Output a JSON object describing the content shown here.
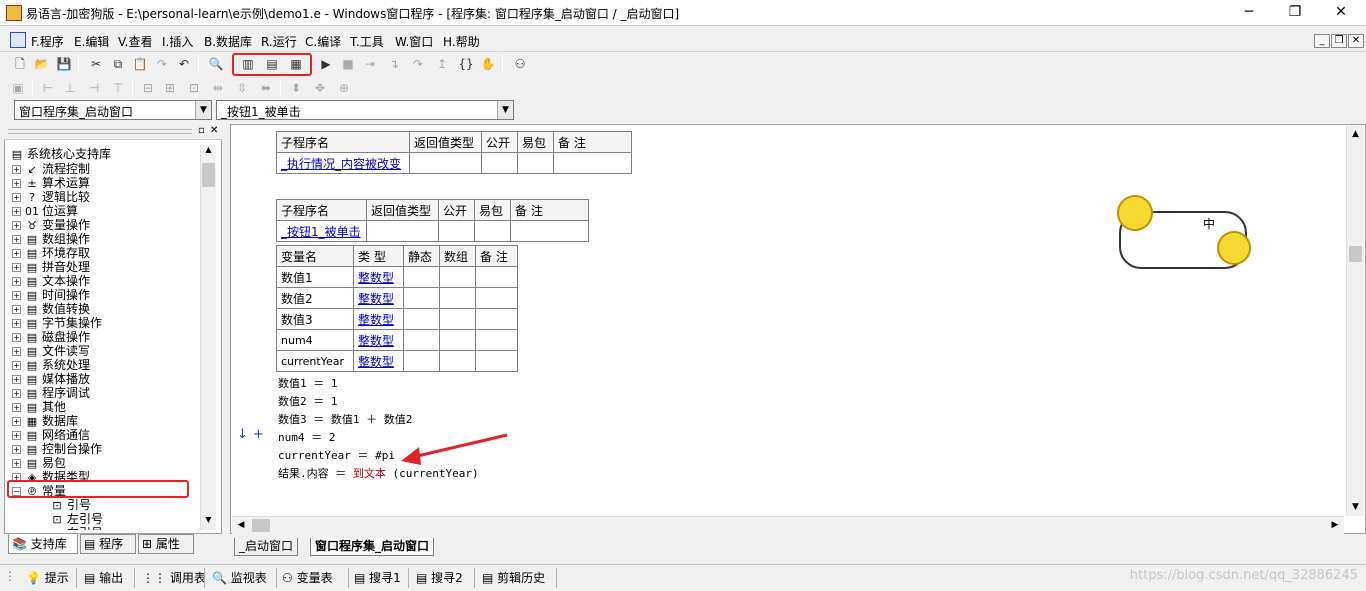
{
  "window": {
    "title": "易语言-加密狗版 - E:\\personal-learn\\e示例\\demo1.e - Windows窗口程序 - [程序集: 窗口程序集_启动窗口 / _启动窗口]"
  },
  "menu": [
    "F.程序",
    "E.编辑",
    "V.查看",
    "I.插入",
    "B.数据库",
    "R.运行",
    "C.编译",
    "T.工具",
    "W.窗口",
    "H.帮助"
  ],
  "combos": {
    "class": "窗口程序集_启动窗口",
    "method": "_按钮1_被单击"
  },
  "tree": {
    "root": "系统核心支持库",
    "items": [
      "流程控制",
      "算术运算",
      "逻辑比较",
      "位运算",
      "变量操作",
      "数组操作",
      "环境存取",
      "拼音处理",
      "文本操作",
      "时间操作",
      "数值转换",
      "字节集操作",
      "磁盘操作",
      "文件读写",
      "系统处理",
      "媒体播放",
      "程序调试",
      "其他",
      "数据库",
      "网络通信",
      "控制台操作",
      "易包",
      "数据类型",
      "常量"
    ],
    "children": [
      "引号",
      "左引号",
      "右引号"
    ]
  },
  "left_tabs": [
    "支持库",
    "程序",
    "属性"
  ],
  "sub1": {
    "headers": [
      "子程序名",
      "返回值类型",
      "公开",
      "易包",
      "备 注"
    ],
    "name": "_执行情况_内容被改变"
  },
  "sub2": {
    "headers": [
      "子程序名",
      "返回值类型",
      "公开",
      "易包",
      "备 注"
    ],
    "name": "_按钮1_被单击"
  },
  "vars": {
    "headers": [
      "变量名",
      "类 型",
      "静态",
      "数组",
      "备 注"
    ],
    "rows": [
      {
        "name": "数值1",
        "type": "整数型"
      },
      {
        "name": "数值2",
        "type": "整数型"
      },
      {
        "name": "数值3",
        "type": "整数型"
      },
      {
        "name": "num4",
        "type": "整数型"
      },
      {
        "name": "currentYear",
        "type": "整数型"
      }
    ]
  },
  "code": {
    "l1": "数值1 ＝ 1",
    "l2": "数值2 ＝ 1",
    "l3": "数值3 ＝ 数值1 ＋ 数值2",
    "l4": "num4 ＝ 2",
    "l5": "currentYear ＝ #pi",
    "l6_a": "结果.内容 ＝ ",
    "l6_b": "到文本",
    "l6_c": " (currentYear)"
  },
  "sticker_text": "中",
  "doc_tabs": [
    "_启动窗口",
    "窗口程序集_启动窗口"
  ],
  "status": [
    "提示",
    "输出",
    "调用表",
    "监视表",
    "变量表",
    "搜寻1",
    "搜寻2",
    "剪辑历史"
  ],
  "watermark": "https://blog.csdn.net/qq_32886245",
  "colors": {
    "highlight": "#e0242a",
    "link": "#0000cc",
    "keyword": "#c00000"
  }
}
